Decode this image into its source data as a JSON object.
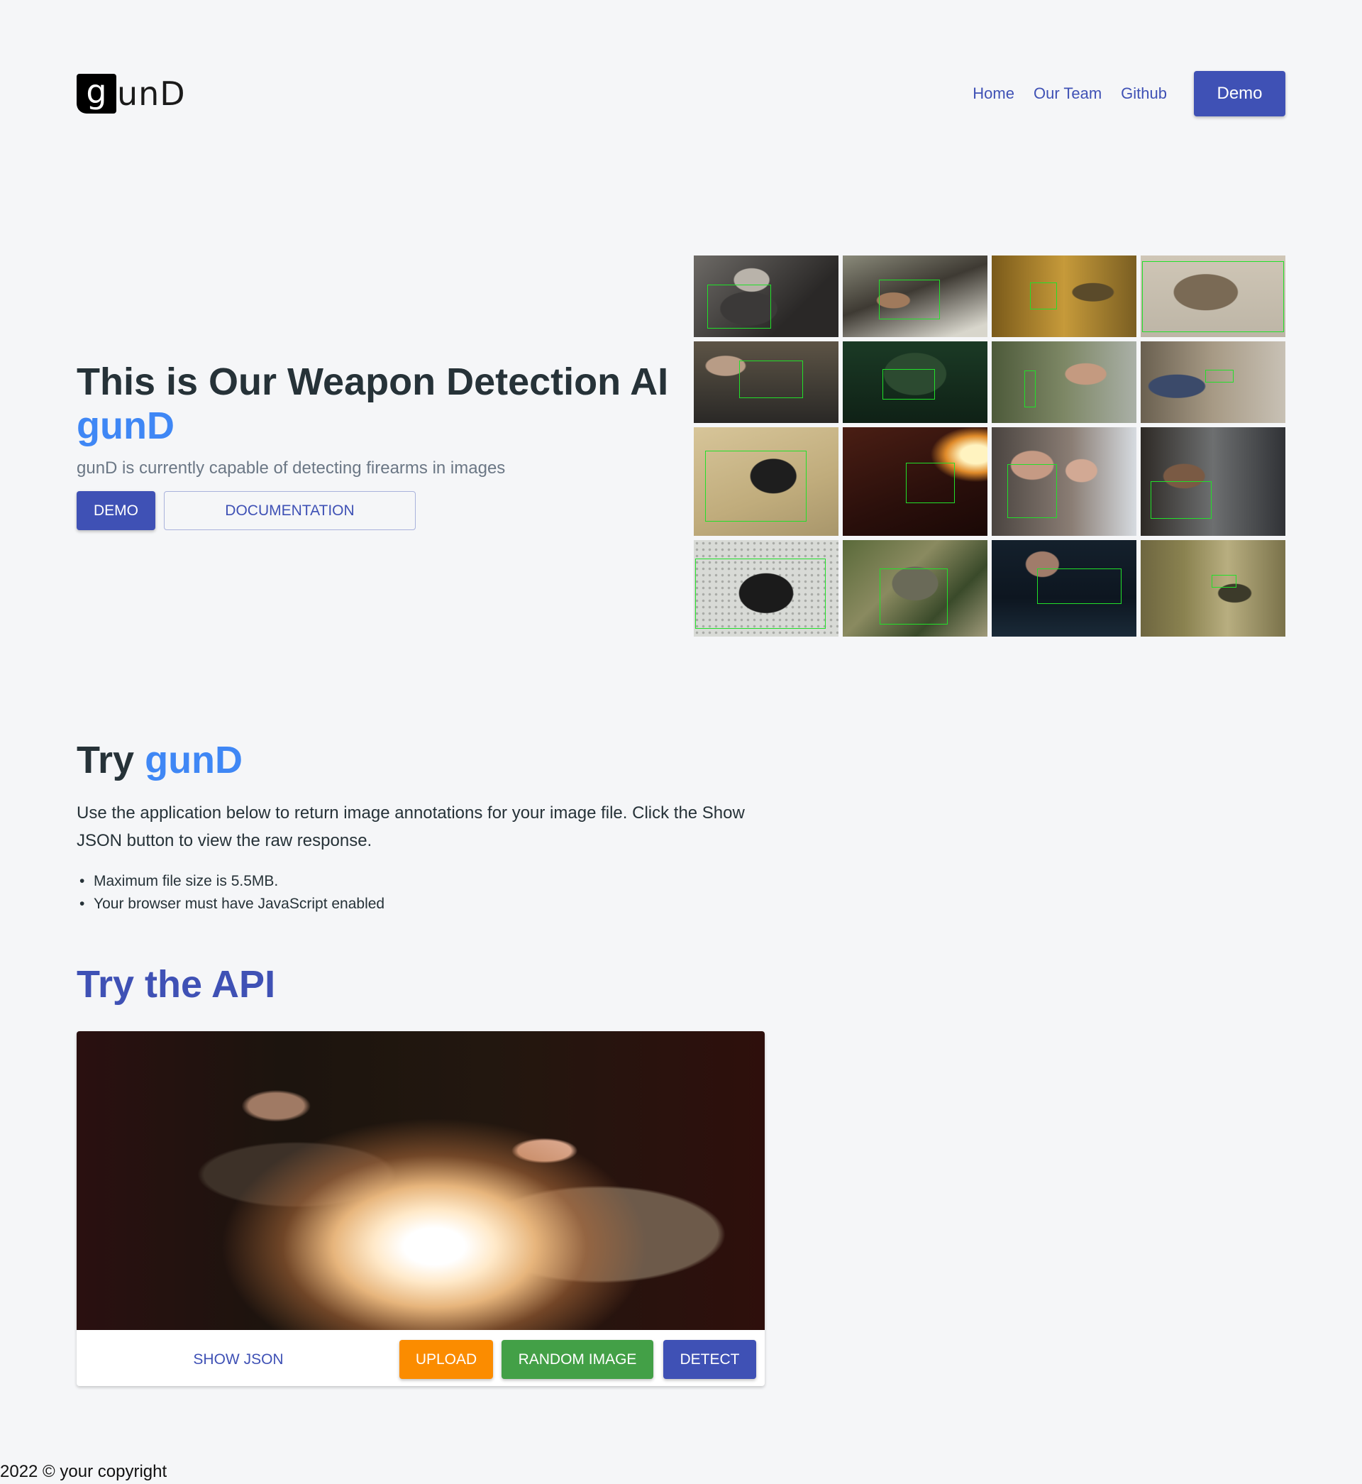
{
  "header": {
    "logo_first": "g",
    "logo_rest": "unD",
    "nav": [
      "Home",
      "Our Team",
      "Github"
    ],
    "demo_label": "Demo"
  },
  "hero": {
    "title": "This is Our Weapon Detection AI",
    "brand": "gunD",
    "subtitle": "gunD is currently capable of detecting firearms in images",
    "demo_button": "DEMO",
    "docs_button": "DOCUMENTATION"
  },
  "gallery": {
    "image_count": 16,
    "description": "Grid of sample movie frames with green bounding boxes around detected firearms"
  },
  "try": {
    "title_plain": "Try",
    "title_accent": "gunD",
    "description": "Use the application below to return image annotations for your image file. Click the Show JSON button to view the raw response.",
    "bullets": [
      "Maximum file size is 5.5MB.",
      "Your browser must have JavaScript enabled"
    ]
  },
  "api": {
    "title": "Try the API",
    "show_json": "SHOW JSON",
    "upload": "UPLOAD",
    "random_image": "RANDOM IMAGE",
    "detect": "DETECT"
  },
  "colors": {
    "primary": "#3f51b5",
    "accent_blue": "#3f87f5",
    "upload_orange": "#fb8c00",
    "random_green": "#43a047",
    "bbox_green": "#22e02a"
  },
  "footer": {
    "copyright": "2022 © your copyright"
  }
}
